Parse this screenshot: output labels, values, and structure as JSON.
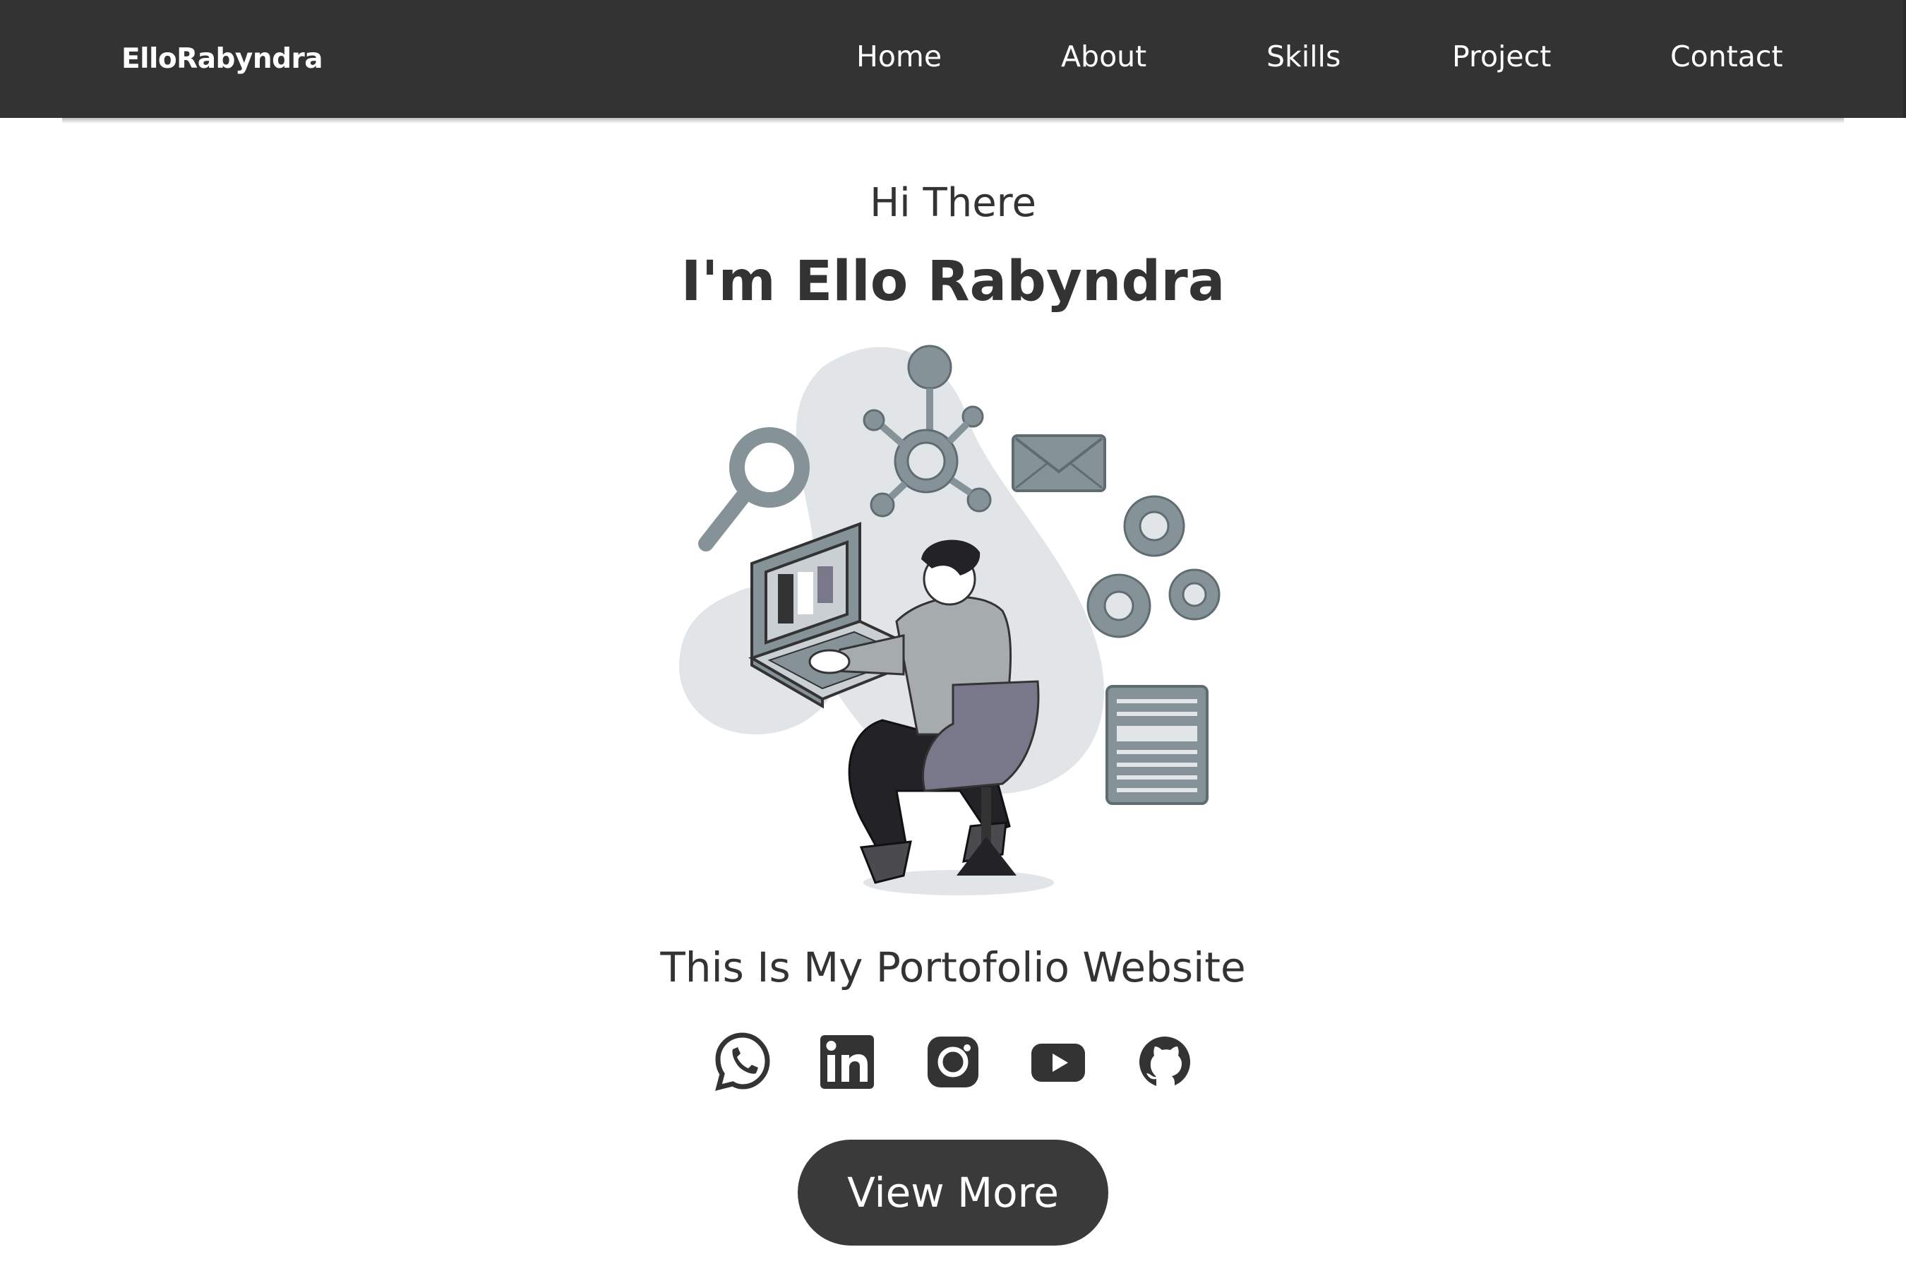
{
  "navbar": {
    "brand": "ElloRabyndra",
    "links": [
      "Home",
      "About",
      "Skills",
      "Project",
      "Contact"
    ]
  },
  "hero": {
    "greeting": "Hi There",
    "name": "I'm Ello Rabyndra",
    "tagline": "This Is My Portofolio Website",
    "illustration_icon": "developer-at-laptop-illustration",
    "cta_label": "View More"
  },
  "socials": [
    {
      "icon": "whatsapp-icon"
    },
    {
      "icon": "linkedin-icon"
    },
    {
      "icon": "instagram-icon"
    },
    {
      "icon": "youtube-icon"
    },
    {
      "icon": "github-icon"
    }
  ],
  "colors": {
    "navbar_bg": "#333333",
    "text": "#333333",
    "button_bg": "#3a3a3a",
    "illustration_blob": "#e2e5e8",
    "illustration_accent": "#859399",
    "chair": "#79788a"
  }
}
